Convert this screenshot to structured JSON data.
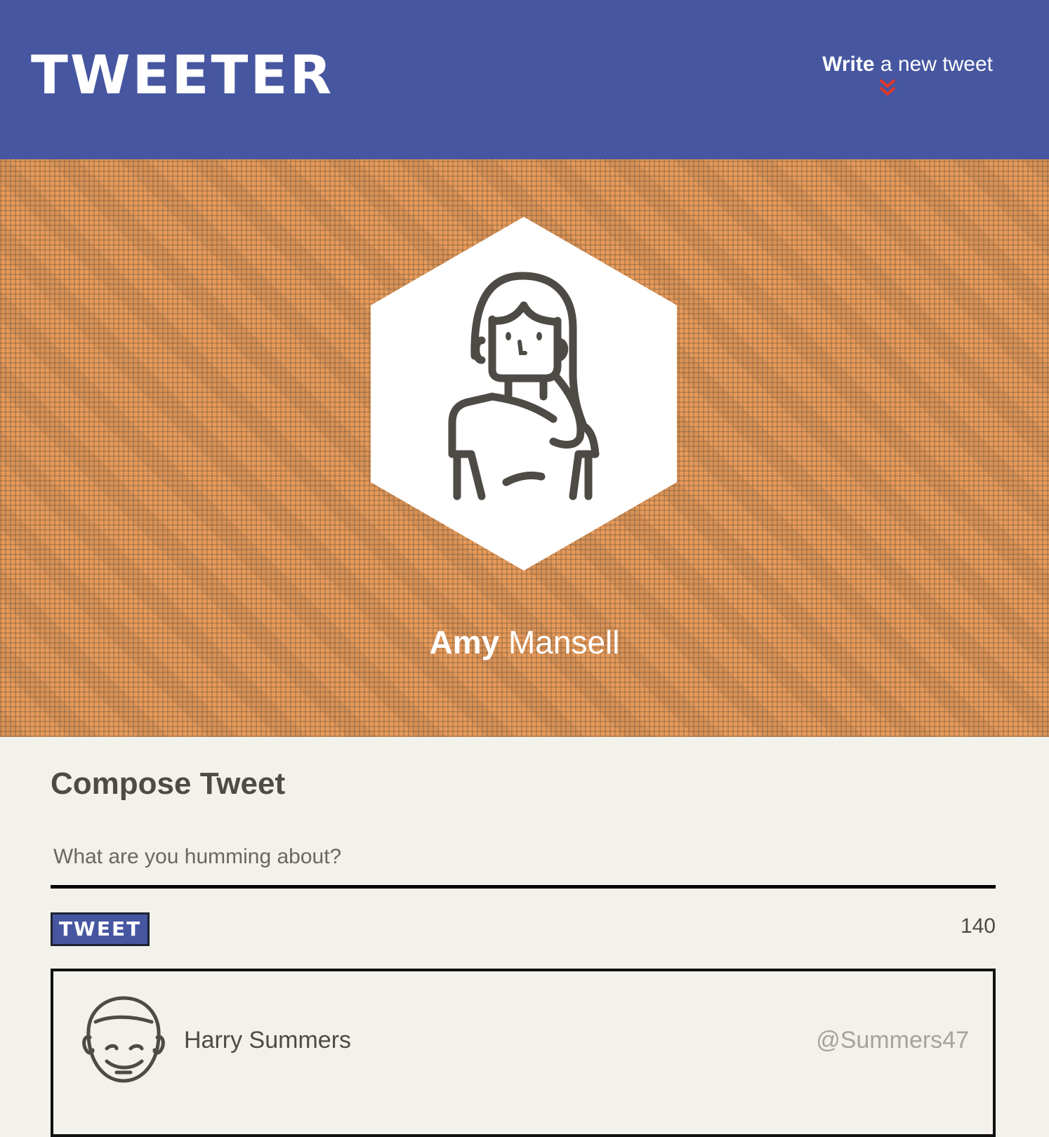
{
  "header": {
    "brand": "TWEETER",
    "compose_toggle": {
      "strong": "Write",
      "light": "a new tweet",
      "icon": "double-chevron-down-icon",
      "icon_color": "#e0372b"
    },
    "background": "#4656a0"
  },
  "profile": {
    "first_name": "Amy",
    "last_name": "Mansell",
    "avatar_icon": "woman-avatar-icon",
    "banner_color": "#e79a5a"
  },
  "compose": {
    "title": "Compose Tweet",
    "placeholder": "What are you humming about?",
    "value": "",
    "button_label": "TWEET",
    "char_count": "140"
  },
  "tweets": [
    {
      "author": "Harry Summers",
      "handle": "@Summers47",
      "avatar_icon": "man-avatar-icon"
    }
  ]
}
